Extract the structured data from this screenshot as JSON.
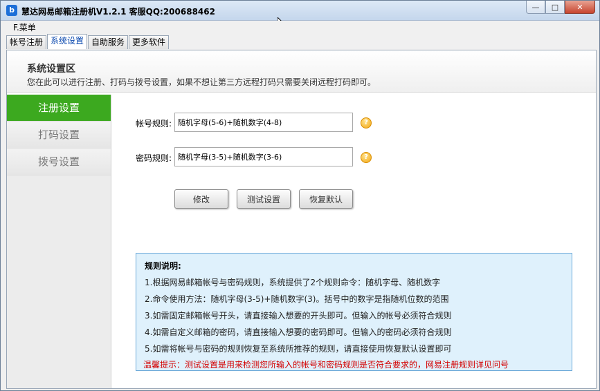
{
  "window": {
    "title": "慧达网易邮箱注册机V1.2.1 客服QQ:200688462",
    "icon": "b",
    "controls": {
      "minimize": "—",
      "maximize": "□",
      "close": "✕"
    }
  },
  "menubar": {
    "items": [
      {
        "label": "F.菜单"
      }
    ]
  },
  "tabs": [
    {
      "label": "帐号注册"
    },
    {
      "label": "系统设置"
    },
    {
      "label": "自助服务"
    },
    {
      "label": "更多软件"
    }
  ],
  "active_tab": "系统设置",
  "header": {
    "title": "系统设置区",
    "description": "您在此可以进行注册、打码与拨号设置，如果不想让第三方远程打码只需要关闭远程打码即可。"
  },
  "sidebar": {
    "items": [
      {
        "label": "注册设置"
      },
      {
        "label": "打码设置"
      },
      {
        "label": "拨号设置"
      }
    ],
    "active": "注册设置"
  },
  "form": {
    "account_rule_label": "帐号规则:",
    "account_rule_value": "随机字母(5-6)+随机数字(4-8)",
    "password_rule_label": "密码规则:",
    "password_rule_value": "随机字母(3-5)+随机数字(3-6)",
    "help_symbol": "?"
  },
  "buttons": {
    "modify": "修改",
    "test": "测试设置",
    "restore": "恢复默认"
  },
  "info": {
    "title": "规则说明:",
    "lines": [
      "1.根据网易邮箱帐号与密码规则，系统提供了2个规则命令：随机字母、随机数字",
      "2.命令使用方法：随机字母(3-5)+随机数字(3)。括号中的数字是指随机位数的范围",
      "3.如需固定邮箱帐号开头，请直接输入想要的开头即可。但输入的帐号必须符合规则",
      "4.如需自定义邮箱的密码，请直接输入想要的密码即可。但输入的密码必须符合规则",
      "5.如需将帐号与密码的规则恢复至系统所推荐的规则，请直接使用恢复默认设置即可"
    ],
    "tip": "温馨提示：测试设置是用来检测您所输入的帐号和密码规则是否符合要求的，网易注册规则详见问号"
  },
  "colors": {
    "sidebar_active": "#3ca91f",
    "tip_text": "#d40000",
    "info_bg": "#dff1fc",
    "tab_active_text": "#0645ad"
  }
}
